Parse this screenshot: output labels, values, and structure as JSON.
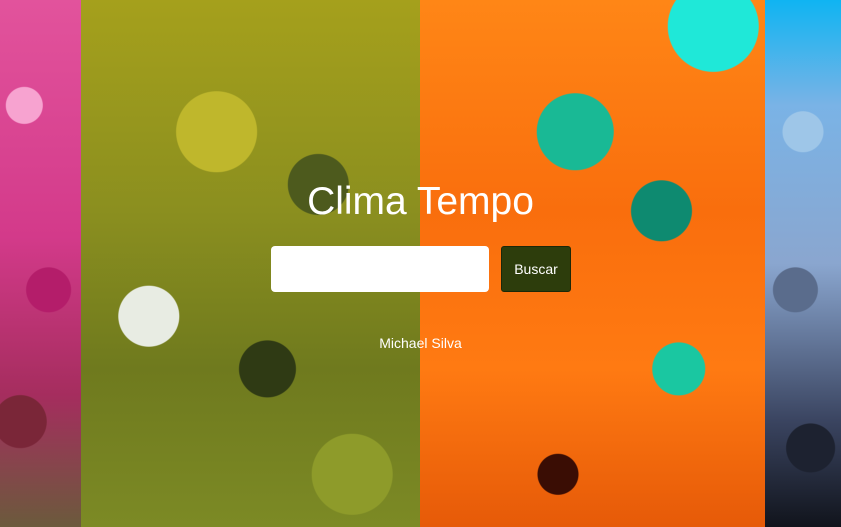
{
  "page": {
    "title": "Clima Tempo"
  },
  "search": {
    "value": "",
    "placeholder": "",
    "button_label": "Buscar"
  },
  "footer": {
    "author": "Michael Silva"
  },
  "colors": {
    "button_bg": "#2d3d0c",
    "text": "#ffffff",
    "input_bg": "#ffffff"
  },
  "background": {
    "panels": [
      "pink-tree",
      "olive-tree",
      "orange-teal-tree",
      "blue-tree"
    ]
  }
}
